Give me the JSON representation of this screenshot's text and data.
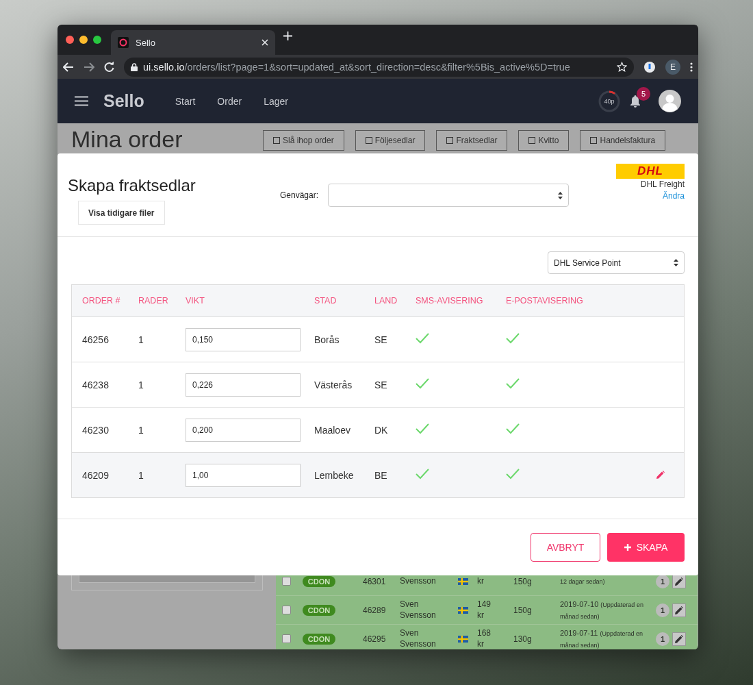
{
  "browser": {
    "tab": {
      "title": "Sello"
    },
    "address": {
      "host": "ui.sello.io",
      "path": "/orders/list?page=1&sort=updated_at&sort_direction=desc&filter%5Bis_active%5D=true"
    },
    "profile_initial": "E"
  },
  "app_header": {
    "logo": "Sello",
    "nav": [
      {
        "label": "Start"
      },
      {
        "label": "Order"
      },
      {
        "label": "Lager"
      }
    ],
    "quota": {
      "label": "40p",
      "level": 0.1
    },
    "notifications": {
      "count": "5"
    }
  },
  "page": {
    "title": "Mina order",
    "actions": [
      "Slå ihop order",
      "Följesedlar",
      "Fraktsedlar",
      "Kvitto",
      "Handelsfaktura"
    ],
    "orders": [
      {
        "checked": false,
        "channel": "CDON",
        "order": "46301",
        "name": [
          "Svensson"
        ],
        "price": [
          "kr"
        ],
        "weight": "150g",
        "note": "12 dagar sedan)",
        "count": "1"
      },
      {
        "checked": false,
        "channel": "CDON",
        "order": "46289",
        "name": [
          "Sven",
          "Svensson"
        ],
        "price": [
          "149",
          "kr"
        ],
        "weight": "150g",
        "date": "2019-07-10",
        "note": "(Uppdaterad en månad sedan)",
        "count": "1"
      },
      {
        "checked": false,
        "channel": "CDON",
        "order": "46295",
        "name": [
          "Sven",
          "Svensson"
        ],
        "price": [
          "168",
          "kr"
        ],
        "weight": "130g",
        "date": "2019-07-11",
        "note": "(Uppdaterad en månad sedan)",
        "count": "1"
      }
    ]
  },
  "modal": {
    "title": "Skapa fraktsedlar",
    "history_button": "Visa tidigare filer",
    "shortcut": {
      "label": "Genvägar:"
    },
    "carrier": {
      "logo": "DHL",
      "name": "DHL Freight",
      "change_link": "Ändra"
    },
    "service": {
      "value": "DHL Service Point"
    },
    "table": {
      "columns": [
        "ORDER #",
        "RADER",
        "VIKT",
        "STAD",
        "LAND",
        "SMS-AVISERING",
        "E-POSTAVISERING"
      ],
      "rows": [
        {
          "order": "46256",
          "rows": "1",
          "weight": "0,150",
          "city": "Borås",
          "country": "SE",
          "sms": true,
          "email": true,
          "highlighted": false
        },
        {
          "order": "46238",
          "rows": "1",
          "weight": "0,226",
          "city": "Västerås",
          "country": "SE",
          "sms": true,
          "email": true,
          "highlighted": false
        },
        {
          "order": "46230",
          "rows": "1",
          "weight": "0,200",
          "city": "Maaloev",
          "country": "DK",
          "sms": true,
          "email": true,
          "highlighted": false
        },
        {
          "order": "46209",
          "rows": "1",
          "weight": "1,00",
          "city": "Lembeke",
          "country": "BE",
          "sms": true,
          "email": true,
          "highlighted": true
        }
      ]
    },
    "buttons": {
      "cancel": "AVBRYT",
      "create": "SKAPA"
    }
  }
}
